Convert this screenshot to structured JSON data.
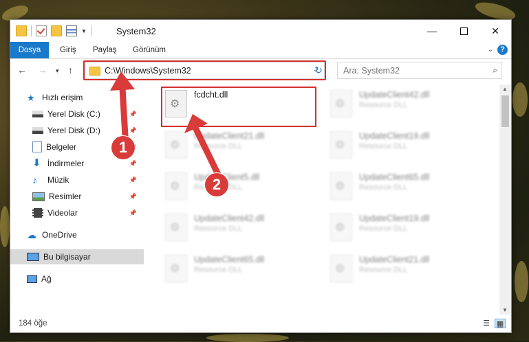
{
  "window": {
    "title": "System32"
  },
  "ribbon": {
    "tabs": [
      "Dosya",
      "Giriş",
      "Paylaş",
      "Görünüm"
    ]
  },
  "address": {
    "path": "C:\\Windows\\System32"
  },
  "search": {
    "placeholder": "Ara: System32"
  },
  "sidebar": {
    "items": [
      {
        "label": "Hızlı erişim"
      },
      {
        "label": "Yerel Disk (C:)"
      },
      {
        "label": "Yerel Disk (D:)"
      },
      {
        "label": "Belgeler"
      },
      {
        "label": "İndirmeler"
      },
      {
        "label": "Müzik"
      },
      {
        "label": "Resimler"
      },
      {
        "label": "Videolar"
      },
      {
        "label": "OneDrive"
      },
      {
        "label": "Bu bilgisayar"
      },
      {
        "label": "Ağ"
      }
    ]
  },
  "files": [
    {
      "name": "fcdcht.dll",
      "type": ""
    },
    {
      "name": "UpdateClient42.dll",
      "type": "Resource DLL"
    },
    {
      "name": "UpdateClient21.dll",
      "type": "Resource DLL"
    },
    {
      "name": "UpdateClient19.dll",
      "type": "Resource DLL"
    },
    {
      "name": "UpdateClient5.dll",
      "type": "Resource DLL"
    },
    {
      "name": "UpdateClient65.dll",
      "type": "Resource DLL"
    },
    {
      "name": "UpdateClient42.dll",
      "type": "Resource DLL"
    },
    {
      "name": "UpdateClient19.dll",
      "type": "Resource DLL"
    },
    {
      "name": "UpdateClient65.dll",
      "type": "Resource DLL"
    },
    {
      "name": "UpdateClient21.dll",
      "type": "Resource DLL"
    }
  ],
  "status": {
    "count": "184 öğe"
  },
  "annotations": {
    "one": "1",
    "two": "2"
  },
  "colors": {
    "accent": "#1979ca",
    "highlight": "#d42f2f"
  }
}
